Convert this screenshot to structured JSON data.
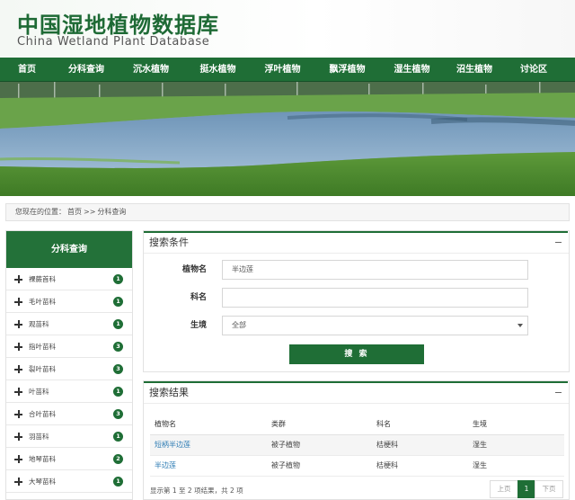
{
  "header": {
    "title": "中国湿地植物数据库",
    "subtitle": "China Wetland Plant Database"
  },
  "nav": {
    "items": [
      {
        "label": "首页",
        "width": 60
      },
      {
        "label": "分科查询",
        "width": 72,
        "active": true
      },
      {
        "label": "沉水植物",
        "width": 72
      },
      {
        "label": "挺水植物",
        "width": 77
      },
      {
        "label": "浮叶植物",
        "width": 67
      },
      {
        "label": "飘浮植物",
        "width": 77
      },
      {
        "label": "湿生植物",
        "width": 67
      },
      {
        "label": "沼生植物",
        "width": 72
      },
      {
        "label": "讨论区",
        "width": 60
      }
    ]
  },
  "breadcrumb": {
    "prefix": "您现在的位置：",
    "home": "首页",
    "sep": ">>",
    "current": "分科查询"
  },
  "sidebar": {
    "title": "分科查询",
    "items": [
      {
        "label": "裸蕨首科",
        "count": "1"
      },
      {
        "label": "毛叶苗科",
        "count": "1"
      },
      {
        "label": "观苗科",
        "count": "1"
      },
      {
        "label": "指叶苗科",
        "count": "3"
      },
      {
        "label": "裂叶苗科",
        "count": "3"
      },
      {
        "label": "叶苗科",
        "count": "1"
      },
      {
        "label": "合叶苗科",
        "count": "3"
      },
      {
        "label": "羽苗科",
        "count": "1"
      },
      {
        "label": "地琴苗科",
        "count": "2"
      },
      {
        "label": "大琴苗科",
        "count": "1"
      },
      {
        "label": "",
        "count": ""
      }
    ]
  },
  "search": {
    "title": "搜索条件",
    "plant_label": "植物名",
    "plant_value": "半边莲",
    "family_label": "科名",
    "family_value": "",
    "habitat_label": "生境",
    "habitat_value": "全部",
    "button_label": "搜 索"
  },
  "results": {
    "title": "搜索结果",
    "columns": [
      "植物名",
      "类群",
      "科名",
      "生境"
    ],
    "rows": [
      {
        "name": "短柄半边莲",
        "group": "被子植物",
        "family": "桔梗科",
        "habitat": "湿生"
      },
      {
        "name": "半边莲",
        "group": "被子植物",
        "family": "桔梗科",
        "habitat": "湿生"
      }
    ],
    "info": "显示第 1 至 2 项结果，共 2 项",
    "prev": "上页",
    "page": "1",
    "next": "下页"
  },
  "colors": {
    "brand_green": "#1f6e36",
    "link_blue": "#2a7ab3"
  }
}
